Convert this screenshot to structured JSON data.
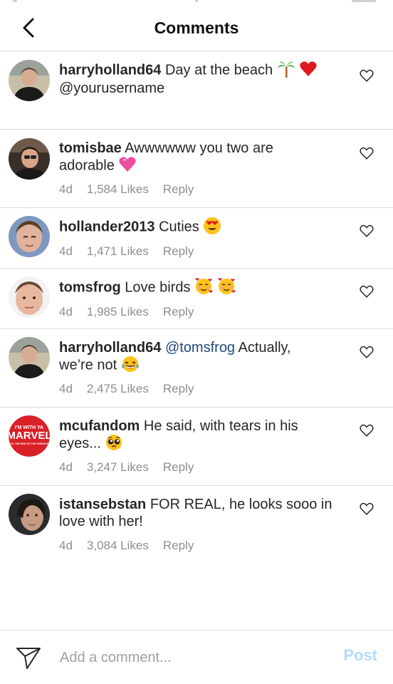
{
  "header": {
    "title": "Comments"
  },
  "comments": [
    {
      "username": "harryholland64",
      "pre": "",
      "mention": "",
      "text": " Day at the beach",
      "line2": "@yourusername",
      "emoji": "palm-heart",
      "time": "",
      "likes": "",
      "reply": ""
    },
    {
      "username": "tomisbae",
      "pre": "",
      "mention": "",
      "text": " Awwwwww you two are",
      "line2": "adorable",
      "emoji": "pink-heart",
      "time": "4d",
      "likes": "1,584 Likes",
      "reply": "Reply"
    },
    {
      "username": "hollander2013",
      "pre": "",
      "mention": "",
      "text": " Cuties",
      "line2": "",
      "emoji": "heart-eyes",
      "time": "4d",
      "likes": "1,471 Likes",
      "reply": "Reply"
    },
    {
      "username": "tomsfrog",
      "pre": "",
      "mention": "",
      "text": " Love birds",
      "line2": "",
      "emoji": "hearts-face-2",
      "time": "4d",
      "likes": "1,985 Likes",
      "reply": "Reply"
    },
    {
      "username": "harryholland64",
      "pre": " ",
      "mention": "@tomsfrog",
      "text": " Actually,",
      "line2": "we’re not",
      "emoji": "laugh-cry",
      "time": "4d",
      "likes": "2,475 Likes",
      "reply": "Reply"
    },
    {
      "username": "mcufandom",
      "pre": "",
      "mention": "",
      "text": " He said, with tears in his",
      "line2": "eyes...",
      "emoji": "pleading",
      "time": "4d",
      "likes": "3,247 Likes",
      "reply": "Reply"
    },
    {
      "username": "istansebstan",
      "pre": "",
      "mention": "",
      "text": " FOR REAL, he looks sooo in",
      "line2": "love with her!",
      "emoji": "",
      "time": "4d",
      "likes": "3,084 Likes",
      "reply": "Reply"
    }
  ],
  "avatars": {
    "marvel_line1": "I'M WITH YA",
    "marvel_line2": "MARVEL",
    "marvel_line3": "TIL THE END OF THE CREDITS"
  },
  "footer": {
    "placeholder": "Add a comment...",
    "post_label": "Post"
  },
  "colors": {
    "accent_post": "#b3dbff",
    "mention": "#1f4a78",
    "meta": "#8e8e8e",
    "divider": "#dbdbdb"
  }
}
